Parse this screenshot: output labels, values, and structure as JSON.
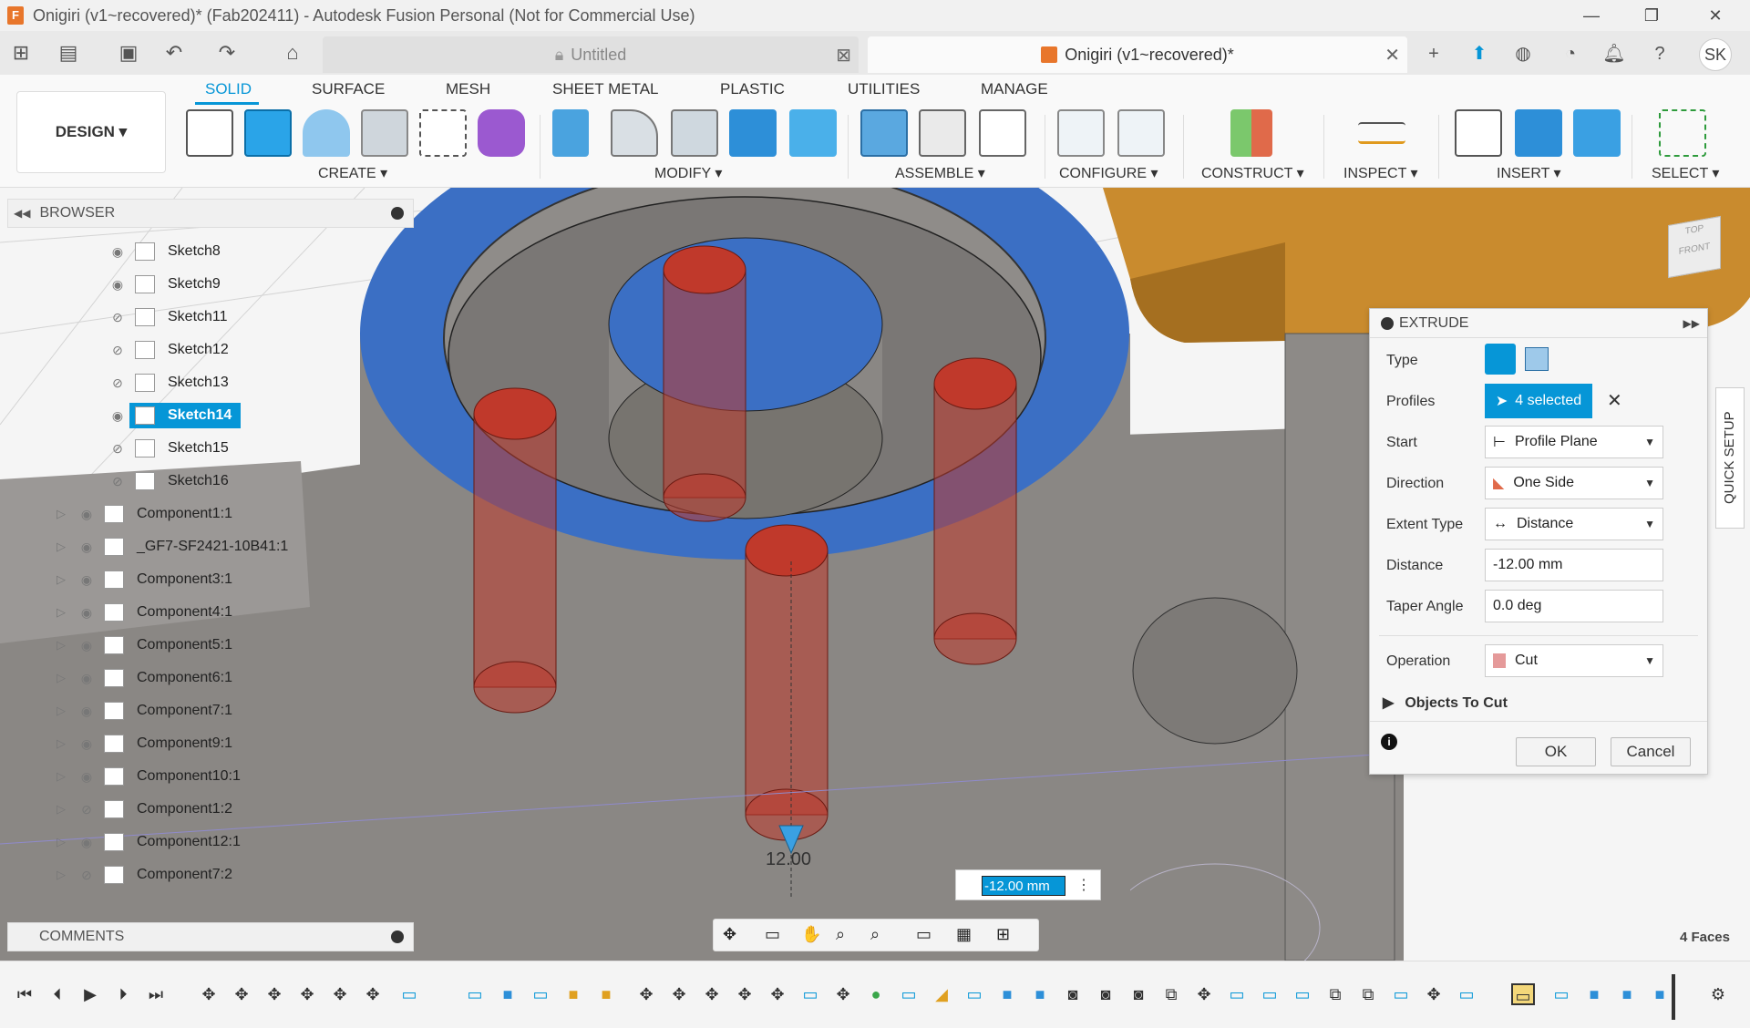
{
  "window": {
    "title": "Onigiri (v1~recovered)* (Fab202411) - Autodesk Fusion Personal (Not for Commercial Use)",
    "logo": "F",
    "minimize": "—",
    "restore": "❐",
    "close": "✕"
  },
  "tabs": {
    "untitled": "Untitled",
    "onigiri": "Onigiri (v1~recovered)*"
  },
  "user": {
    "initials": "SK"
  },
  "ribbon": {
    "workspace": "DESIGN ▾",
    "tabs": [
      "SOLID",
      "SURFACE",
      "MESH",
      "SHEET METAL",
      "PLASTIC",
      "UTILITIES",
      "MANAGE"
    ],
    "groups": [
      "CREATE ▾",
      "MODIFY ▾",
      "ASSEMBLE ▾",
      "CONFIGURE ▾",
      "CONSTRUCT ▾",
      "INSPECT ▾",
      "INSERT ▾",
      "SELECT ▾"
    ]
  },
  "browser": {
    "title": "BROWSER",
    "sketches": [
      "Sketch8",
      "Sketch9",
      "Sketch11",
      "Sketch12",
      "Sketch13",
      "Sketch14",
      "Sketch15",
      "Sketch16"
    ],
    "components": [
      "Component1:1",
      "_GF7-SF2421-10B41:1",
      "Component3:1",
      "Component4:1",
      "Component5:1",
      "Component6:1",
      "Component7:1",
      "Component9:1",
      "Component10:1",
      "Component1:2",
      "Component12:1",
      "Component7:2"
    ]
  },
  "extrude": {
    "title": "EXTRUDE",
    "labels": {
      "type": "Type",
      "profiles": "Profiles",
      "start": "Start",
      "direction": "Direction",
      "extent_type": "Extent Type",
      "distance": "Distance",
      "taper": "Taper Angle",
      "operation": "Operation",
      "objects_to_cut": "Objects To Cut"
    },
    "values": {
      "profiles": "4 selected",
      "start": "Profile Plane",
      "direction": "One Side",
      "extent_type": "Distance",
      "distance": "-12.00 mm",
      "taper": "0.0 deg",
      "operation": "Cut"
    },
    "ok": "OK",
    "cancel": "Cancel"
  },
  "viewport": {
    "dimension_label": "12.00",
    "dim_input": "-12.00 mm",
    "faces": "4 Faces",
    "quick_setup": "QUICK SETUP",
    "viewcube_top": "TOP",
    "viewcube_front": "FRONT"
  },
  "comments": {
    "title": "COMMENTS"
  },
  "colors": {
    "accent": "#0696d7",
    "selection_blue": "#3b6fc4",
    "cut_red": "#c0392b",
    "body_gray": "#8a8784",
    "orange_body": "#c98b2e"
  }
}
